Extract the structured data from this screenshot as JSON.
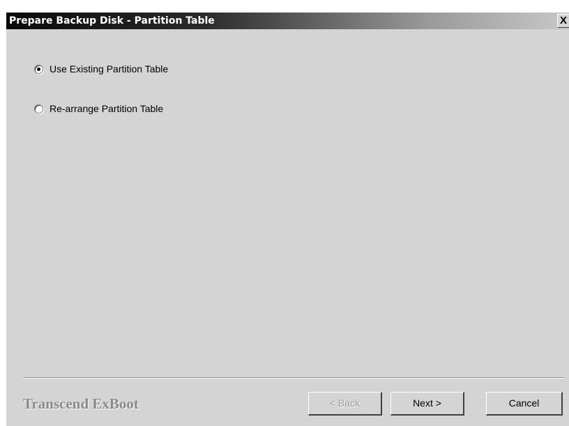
{
  "window": {
    "title": "Prepare Backup Disk - Partition Table",
    "close_label": "X"
  },
  "options": [
    {
      "label": "Use Existing Partition Table",
      "selected": true
    },
    {
      "label": "Re-arrange Partition Table",
      "selected": false
    }
  ],
  "footer": {
    "brand": "Transcend ExBoot",
    "back_label": "< Back",
    "back_enabled": false,
    "next_label": "Next >",
    "cancel_label": "Cancel"
  },
  "colors": {
    "dialog_background": "#d4d4d4",
    "title_text": "#ffffff",
    "brand_text": "#8a8a8a"
  }
}
